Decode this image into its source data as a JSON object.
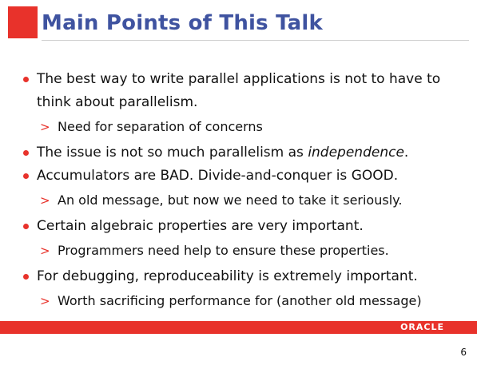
{
  "slide": {
    "title": "Main Points of This Talk",
    "page_number": "6",
    "logo_text": "ORACLE",
    "accent_color": "#e8322b",
    "title_color": "#3f53a0",
    "sub_marker": ">",
    "bullets": [
      {
        "text": "The best way to write parallel applications is not to have to think about parallelism.",
        "subs": [
          "Need for separation of concerns"
        ]
      },
      {
        "text_before": "The issue is not so much parallelism as ",
        "text_emphasis": "independence",
        "text_after": ".",
        "subs": []
      },
      {
        "text": "Accumulators are BAD. Divide-and-conquer is GOOD.",
        "subs": [
          "An old message, but now we need to take it seriously."
        ]
      },
      {
        "text": "Certain algebraic properties are very important.",
        "subs": [
          "Programmers need help to ensure these properties."
        ]
      },
      {
        "text": "For debugging, reproduceability is extremely important.",
        "subs": [
          "Worth sacrificing performance for (another old message)"
        ]
      }
    ]
  }
}
